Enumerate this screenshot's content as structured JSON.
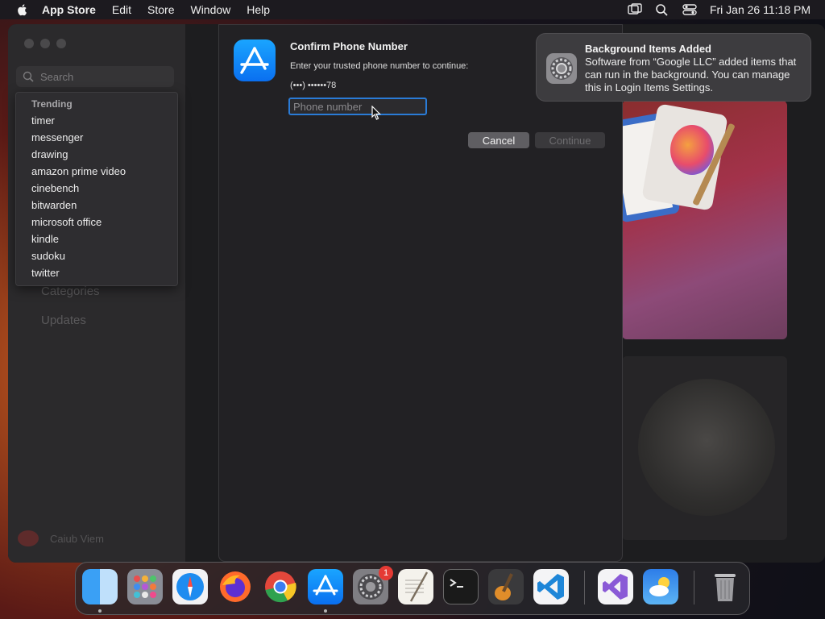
{
  "menubar": {
    "app_name": "App Store",
    "items": [
      "Edit",
      "Store",
      "Window",
      "Help"
    ],
    "clock": "Fri Jan 26  11:18 PM"
  },
  "store_window": {
    "search_placeholder": "Search",
    "sidebar_links": [
      "Categories",
      "Updates"
    ],
    "user_name": "Caiub Viem"
  },
  "trending": {
    "header": "Trending",
    "items": [
      "timer",
      "messenger",
      "drawing",
      "amazon prime video",
      "cinebench",
      "bitwarden",
      "microsoft office",
      "kindle",
      "sudoku",
      "twitter"
    ]
  },
  "dialog": {
    "title": "Confirm Phone Number",
    "message": "Enter your trusted phone number to continue:",
    "masked_number": "(•••) ••••••78",
    "input_placeholder": "Phone number",
    "input_value": "",
    "cancel_label": "Cancel",
    "continue_label": "Continue"
  },
  "notification": {
    "title": "Background Items Added",
    "body": "Software from “Google LLC” added items that can run in the background. You can manage this in Login Items Settings."
  },
  "dock": {
    "apps": [
      "Finder",
      "Launchpad",
      "Safari",
      "Firefox",
      "Chrome",
      "App Store",
      "System Settings",
      "TextEdit",
      "Terminal",
      "GarageBand",
      "Visual Studio Code",
      "Visual Studio",
      "Weather",
      "Trash"
    ],
    "system_settings_badge": "1"
  }
}
